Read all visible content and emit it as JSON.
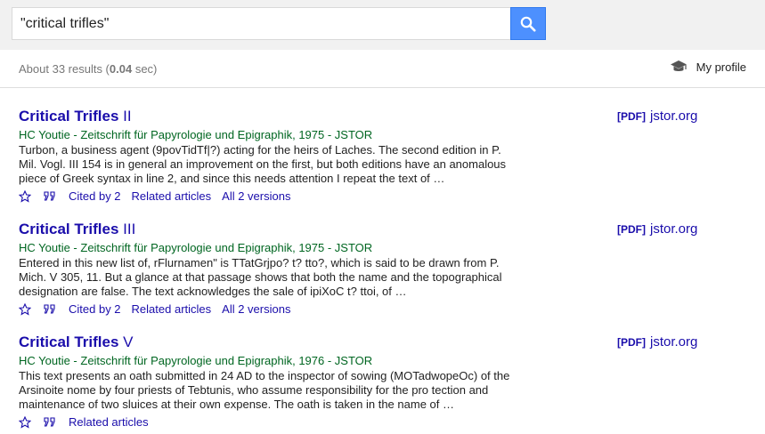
{
  "search": {
    "query": "\"critical trifles\""
  },
  "stats": {
    "prefix": "About 33 results (",
    "time": "0.04",
    "suffix": " sec)"
  },
  "profile": {
    "label": "My profile",
    "icon": "graduation-cap-icon"
  },
  "colors": {
    "search_button": "#4d90fe",
    "link": "#1a0dab",
    "meta": "#006621"
  },
  "results": [
    {
      "title": "Critical Trifles",
      "numeral": "II",
      "meta": "HC Youtie - Zeitschrift für Papyrologie und Epigraphik, 1975 - JSTOR",
      "snippet": "Turbon, a business agent (9povTidTf|?) acting for the heirs of Laches. The second edition in P. Mil. Vogl. III 154 is in general an improvement on the first, but both editions have an anomalous piece of Greek syntax in line 2, and since this needs attention I repeat the text of …",
      "cited_by": "Cited by 2",
      "related": "Related articles",
      "versions": "All 2 versions",
      "pdf_tag": "[PDF]",
      "pdf_source": "jstor.org"
    },
    {
      "title": "Critical Trifles",
      "numeral": "III",
      "meta": "HC Youtie - Zeitschrift für Papyrologie und Epigraphik, 1975 - JSTOR",
      "snippet": "Entered in this new list of, rFlurnamen\" is TTatGrjpo? t? tto?, which is said to be drawn from P. Mich. V 305, 11. But a glance at that passage shows that both the name and the topographical designation are false. The text acknowledges the sale of ipiXoC t? ttoi, of …",
      "cited_by": "Cited by 2",
      "related": "Related articles",
      "versions": "All 2 versions",
      "pdf_tag": "[PDF]",
      "pdf_source": "jstor.org"
    },
    {
      "title": "Critical Trifles",
      "numeral": "V",
      "meta": "HC Youtie - Zeitschrift für Papyrologie und Epigraphik, 1976 - JSTOR",
      "snippet": "This text presents an oath submitted in 24 AD to the inspector of sowing (MOTadwopeOc) of the Arsinoite nome by four priests of Tebtunis, who assume responsibility for the pro tection and maintenance of two sluices at their own expense. The oath is taken in the name of …",
      "related": "Related articles",
      "pdf_tag": "[PDF]",
      "pdf_source": "jstor.org"
    }
  ]
}
